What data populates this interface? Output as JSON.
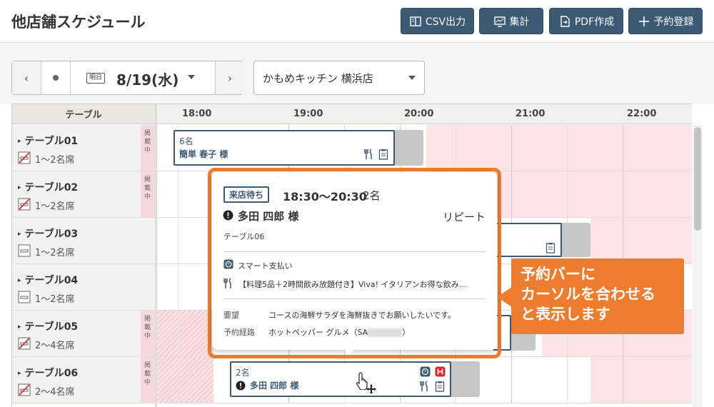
{
  "header": {
    "title": "他店舗スケジュール",
    "buttons": [
      {
        "label": "CSV出力",
        "icon": "book-icon"
      },
      {
        "label": "集計",
        "icon": "monitor-chart-icon"
      },
      {
        "label": "PDF作成",
        "icon": "document-arrow-icon"
      },
      {
        "label": "予約登録",
        "icon": "plus-icon"
      }
    ]
  },
  "toolbar": {
    "tomorrow_badge": "明日",
    "date": "8/19(水)",
    "store": "かもめキッチン 横浜店"
  },
  "grid": {
    "column_header": "テーブル",
    "times": [
      "18:00",
      "19:00",
      "20:00",
      "21:00",
      "22:00"
    ],
    "publish_label": "掲載中",
    "rows": [
      {
        "name": "テーブル01",
        "seats": "1〜2名席",
        "smoking": "no-smoking-icon",
        "published": true
      },
      {
        "name": "テーブル02",
        "seats": "1〜2名席",
        "smoking": "no-smoking-icon",
        "published": true
      },
      {
        "name": "テーブル03",
        "seats": "1〜2名席",
        "smoking": "smoking-icon",
        "published": false
      },
      {
        "name": "テーブル04",
        "seats": "1〜2名席",
        "smoking": "smoking-icon",
        "published": false
      },
      {
        "name": "テーブル05",
        "seats": "2〜4名席",
        "smoking": "no-smoking-icon",
        "published": true
      },
      {
        "name": "テーブル06",
        "seats": "2〜4名席",
        "smoking": "no-smoking-icon",
        "published": true
      }
    ],
    "reservations": [
      {
        "count": "6名",
        "name": "簡単 春子 様"
      },
      {
        "count": "2名",
        "name": "多田 四郎 様"
      }
    ]
  },
  "popup": {
    "status": "来店待ち",
    "time": "18:30〜20:30",
    "count": "2名",
    "name": "多田 四郎 様",
    "repeat": "リピート",
    "table": "テーブル06",
    "smart_pay": "スマート支払い",
    "course": "【料理5品＋2時間飲み放題付き】Viva! イタリアンお得な飲み…",
    "request_label": "要望",
    "request": "コースの海鮮サラダを海鮮抜きでお願いしたいです。",
    "route_label": "予約経路",
    "route_prefix": "ホットペッパー グルメ（SA",
    "route_suffix": "）"
  },
  "callout": {
    "line1": "予約バーに",
    "line2": "カーソルを合わせる",
    "line3": "と表示します"
  },
  "colors": {
    "navy": "#3d5a75",
    "orange": "#ee7c2e",
    "pink": "#fbe3e6",
    "red": "#d9262c"
  }
}
